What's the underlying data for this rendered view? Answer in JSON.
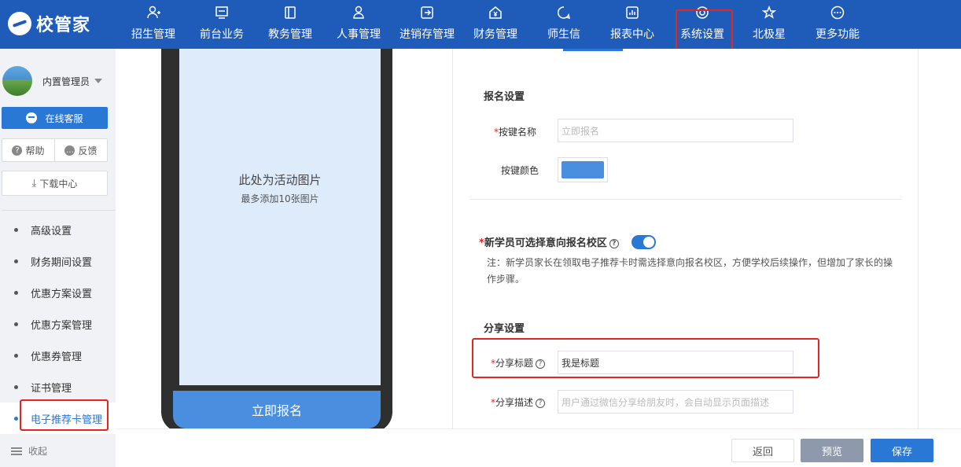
{
  "brand": {
    "logo_text": "校管家"
  },
  "nav": {
    "items": [
      {
        "label": "招生管理",
        "icon": "user-plus-icon"
      },
      {
        "label": "前台业务",
        "icon": "monitor-icon"
      },
      {
        "label": "教务管理",
        "icon": "book-icon"
      },
      {
        "label": "人事管理",
        "icon": "person-icon"
      },
      {
        "label": "进销存管理",
        "icon": "inventory-icon"
      },
      {
        "label": "财务管理",
        "icon": "yuan-house-icon"
      },
      {
        "label": "师生信",
        "icon": "message-circle-icon"
      },
      {
        "label": "报表中心",
        "icon": "bar-chart-icon"
      },
      {
        "label": "系统设置",
        "icon": "settings-target-icon",
        "active": true
      },
      {
        "label": "北极星",
        "icon": "star-icon"
      },
      {
        "label": "更多功能",
        "icon": "more-dots-icon"
      }
    ]
  },
  "sidebar": {
    "user_name": "内置管理员",
    "service_label": "在线客服",
    "help_label": "帮助",
    "feedback_label": "反馈",
    "download_label": "下载中心",
    "menu": [
      {
        "label": "高级设置"
      },
      {
        "label": "财务期间设置"
      },
      {
        "label": "优惠方案设置"
      },
      {
        "label": "优惠方案管理"
      },
      {
        "label": "优惠券管理"
      },
      {
        "label": "证书管理"
      },
      {
        "label": "电子推荐卡管理",
        "active": true
      }
    ],
    "collapse_label": "收起"
  },
  "preview": {
    "picture_title": "此处为活动图片",
    "picture_sub": "最多添加10张图片",
    "signup_button": "立即报名"
  },
  "form": {
    "signup_section": "报名设置",
    "button_name_label": "按键名称",
    "button_name_placeholder": "立即报名",
    "button_color_label": "按键颜色",
    "button_color": "#4a8ee0",
    "campus_option_label": "新学员可选择意向报名校区",
    "campus_option_enabled": true,
    "campus_note": "注：新学员家长在领取电子推荐卡时需选择意向报名校区，方便学校后续操作，但增加了家长的操作步骤。",
    "share_section": "分享设置",
    "share_title_label": "分享标题",
    "share_title_value": "我是标题",
    "share_desc_label": "分享描述",
    "share_desc_placeholder": "用户通过微信分享给朋友时，会自动显示页面描述"
  },
  "actions": {
    "back": "返回",
    "preview": "预览",
    "save": "保存"
  },
  "colors": {
    "nav_bg": "#1f5bb8",
    "accent": "#2a78d6",
    "highlight": "#e8241e"
  }
}
